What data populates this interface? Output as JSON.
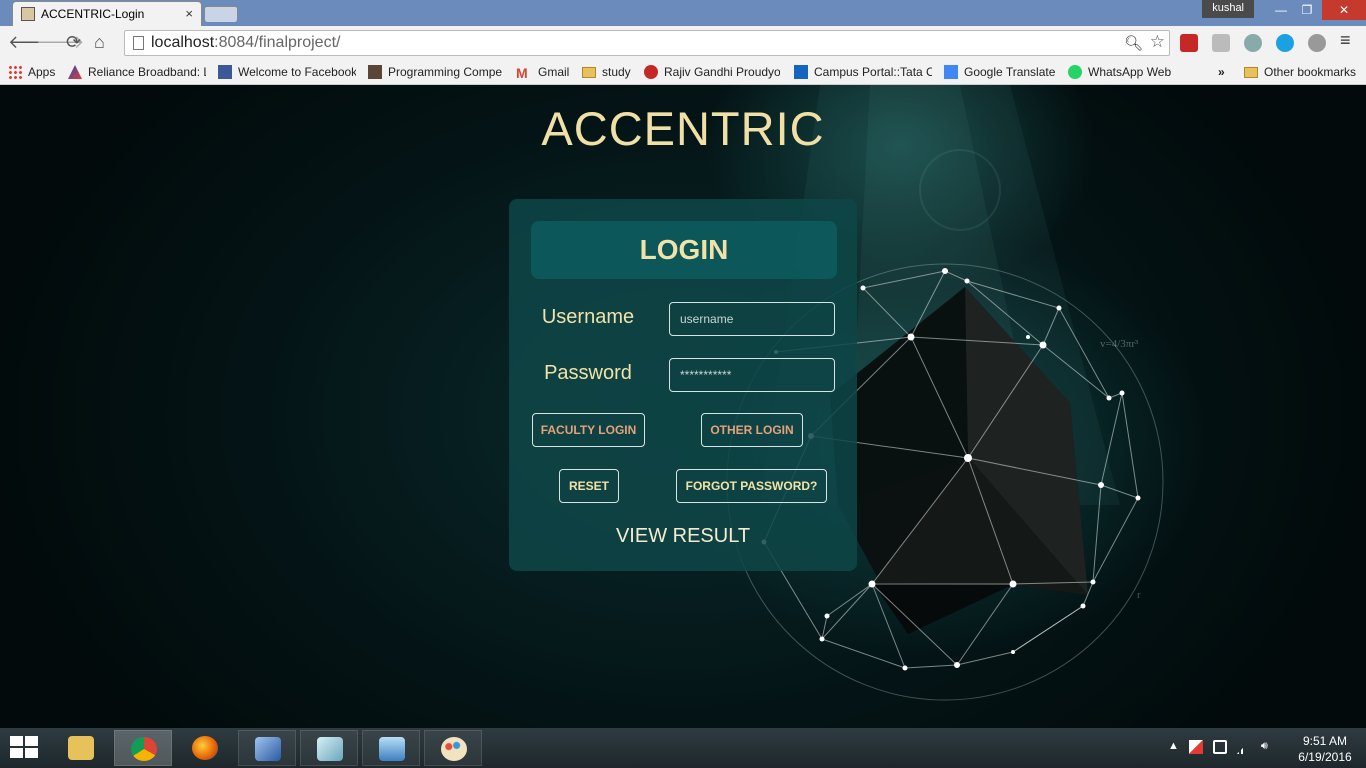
{
  "browser": {
    "tab_title": "ACCENTRIC-Login",
    "tab_close": "×",
    "user_name": "kushal",
    "window_min": "—",
    "window_max": "❐",
    "window_close": "✕",
    "url_host": "localhost",
    "url_rest": ":8084/finalproject/",
    "bookmarks": [
      {
        "label": "Apps"
      },
      {
        "label": "Reliance Broadband: Login"
      },
      {
        "label": "Welcome to Facebook"
      },
      {
        "label": "Programming Competition"
      },
      {
        "label": "Gmail"
      },
      {
        "label": "study"
      },
      {
        "label": "Rajiv Gandhi Proudyogiki"
      },
      {
        "label": "Campus Portal::Tata Consultancy"
      },
      {
        "label": "Google Translate"
      },
      {
        "label": "WhatsApp Web"
      },
      {
        "label": "»"
      },
      {
        "label": "Other bookmarks"
      }
    ]
  },
  "page": {
    "site_title": "ACCENTRIC",
    "login_header": "LOGIN",
    "username_label": "Username",
    "username_placeholder": "username",
    "password_label": "Password",
    "password_value": "***********",
    "faculty_login": "FACULTY LOGIN",
    "other_login": "OTHER LOGIN",
    "reset": "RESET",
    "forgot_password": "FORGOT PASSWORD?",
    "view_result": "VIEW RESULT",
    "background_formula": "v=4/3πr³",
    "background_r": "r",
    "accent_color": "#f1e0a6"
  },
  "taskbar": {
    "time": "9:51 AM",
    "date": "6/19/2016",
    "tray_caret": "▲"
  }
}
